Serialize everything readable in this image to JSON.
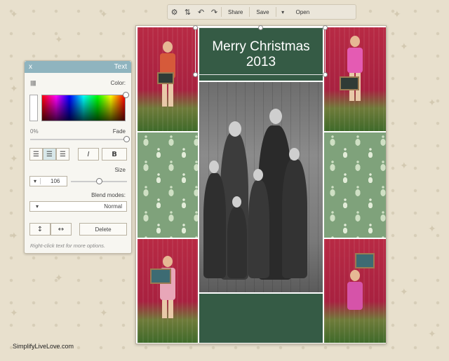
{
  "toolbar": {
    "settings_icon": "gear-icon",
    "sort_icon": "sort-layers-icon",
    "undo_icon": "undo-icon",
    "redo_icon": "redo-icon",
    "share_label": "Share",
    "save_label": "Save",
    "open_label": "Open",
    "open_menu_icon": "chevron-down-icon"
  },
  "card": {
    "title_line1": "Merry Christmas",
    "title_line2": "2013"
  },
  "text_panel": {
    "title": "Text",
    "close_label": "x",
    "color_label": "Color:",
    "fade_label": "Fade",
    "fade_value": "0%",
    "size_label": "Size",
    "size_value": "106",
    "blend_label": "Blend modes:",
    "blend_value": "Normal",
    "bold_label": "B",
    "italic_label": "I",
    "delete_label": "Delete",
    "hint": "Right-click text for more options.",
    "align_icons": [
      "align-right-icon",
      "align-center-icon",
      "align-left-icon"
    ],
    "flip_icons": [
      "flip-vertical-icon",
      "flip-horizontal-icon"
    ],
    "fade_level": 1.0
  },
  "watermark": "SimplifyLiveLove.com",
  "colors": {
    "panel_header": "#8fb4bf",
    "card_green": "#355b45",
    "background": "#e8e0cd"
  }
}
